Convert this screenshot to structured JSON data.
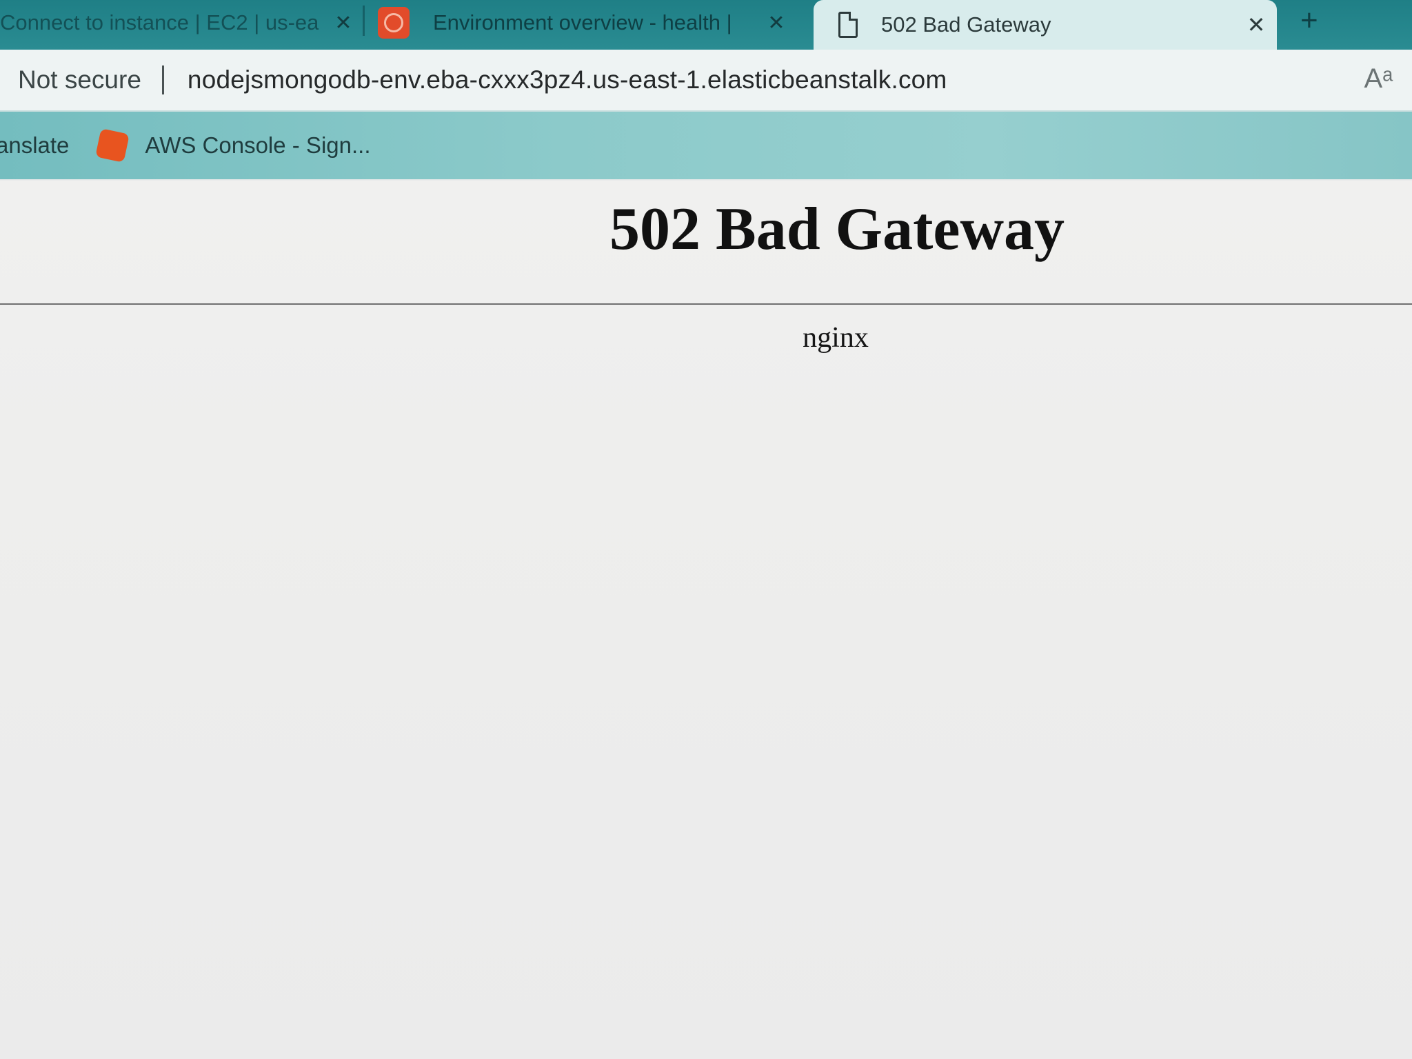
{
  "tabs": [
    {
      "title": "Connect to instance | EC2 | us-ea",
      "close_glyph": "✕",
      "active": false
    },
    {
      "title": "Environment overview - health |",
      "close_glyph": "✕",
      "active": false,
      "favicon": "elastic-beanstalk-icon"
    },
    {
      "title": "502 Bad Gateway",
      "close_glyph": "✕",
      "active": true,
      "favicon": "document-icon"
    }
  ],
  "new_tab_glyph": "+",
  "address_bar": {
    "security_label": "Not secure",
    "url": "nodejsmongodb-env.eba-cxxx3pz4.us-east-1.elasticbeanstalk.com",
    "read_aloud_glyph": "Aᵃ"
  },
  "favorites": [
    {
      "label": "anslate",
      "icon": ""
    },
    {
      "label": "AWS Console - Sign...",
      "icon": "aws-icon"
    }
  ],
  "page": {
    "heading": "502 Bad Gateway",
    "server": "nginx"
  },
  "colors": {
    "tabstrip": "#1f7f86",
    "active_tab": "#d8ecec",
    "favorites_bar": "#8ccaca",
    "aws_icon": "#e8541f",
    "favicon_beanstalk": "#e24b2a"
  }
}
